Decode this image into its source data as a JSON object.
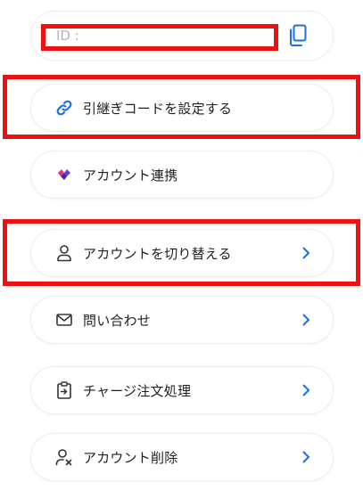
{
  "id_row": {
    "label": "ID :",
    "value": "",
    "copy_icon": "copy-icon"
  },
  "menu": [
    {
      "label": "引継ぎコードを設定する",
      "icon": "link-icon",
      "has_chevron": false
    },
    {
      "label": "アカウント連携",
      "icon": "diamond-logo-icon",
      "has_chevron": false
    },
    {
      "label": "アカウントを切り替える",
      "icon": "user-icon",
      "has_chevron": true
    },
    {
      "label": "問い合わせ",
      "icon": "mail-icon",
      "has_chevron": true
    },
    {
      "label": "チャージ注文処理",
      "icon": "clipboard-arrow-icon",
      "has_chevron": true
    },
    {
      "label": "アカウント削除",
      "icon": "user-remove-icon",
      "has_chevron": true
    }
  ],
  "colors": {
    "accent": "#1e6fe0",
    "highlight": "#ee1111",
    "text": "#1f1f1f",
    "muted": "#b5b5b5"
  }
}
